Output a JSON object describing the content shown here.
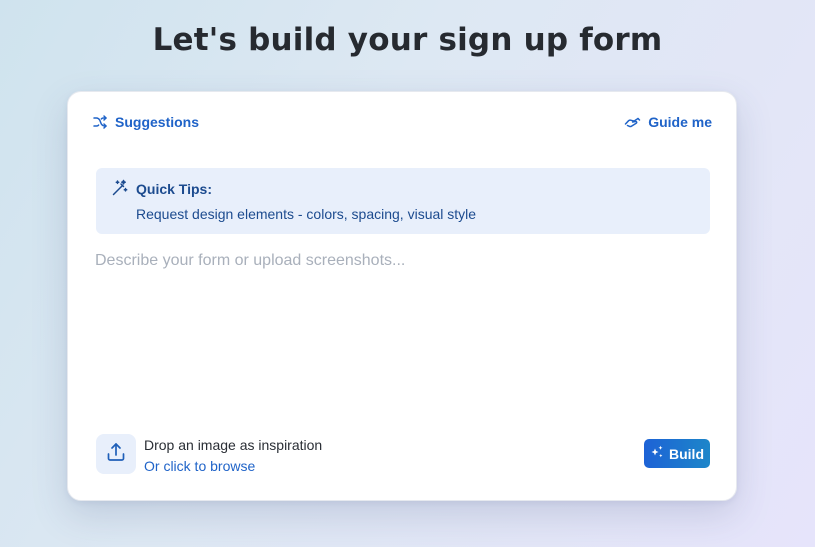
{
  "header": {
    "title": "Let's build your sign up form"
  },
  "toolbar": {
    "suggestions_label": "Suggestions",
    "suggestions_icon": "shuffle-icon",
    "guide_label": "Guide me",
    "guide_icon": "handshake-icon"
  },
  "tips": {
    "icon": "magic-wand-icon",
    "title": "Quick Tips:",
    "text": "Request design elements - colors, spacing, visual style"
  },
  "prompt": {
    "placeholder": "Describe your form or upload screenshots...",
    "value": ""
  },
  "upload": {
    "icon": "upload-icon",
    "title": "Drop an image as inspiration",
    "browse_label": "Or click to browse"
  },
  "build": {
    "label": "Build",
    "icon": "sparkles-icon"
  },
  "colors": {
    "accent": "#1f63c8",
    "tips_bg": "#e8effb",
    "tips_text": "#1c4b8f",
    "heading": "#262a30"
  }
}
